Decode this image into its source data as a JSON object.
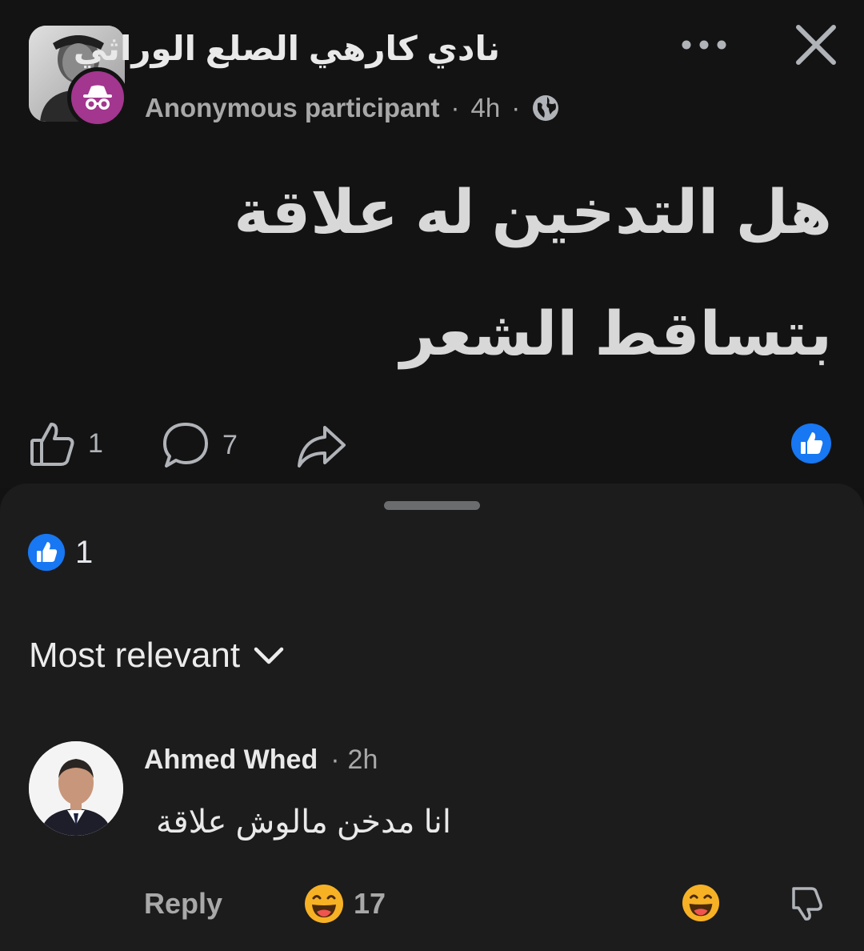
{
  "post": {
    "group_name": "نادي كارهي الصلع الوراثي",
    "author": "Anonymous participant",
    "separator": "·",
    "age": "4h",
    "privacy_icon": "globe-icon",
    "body": "هل التدخين له علاقة بتساقط الشعر",
    "like_count": "1",
    "comment_count": "7"
  },
  "sheet": {
    "reaction_count": "1",
    "sort_label": "Most relevant"
  },
  "comment": {
    "author": "Ahmed Whed",
    "separator": "·",
    "age": "2h",
    "text": "انا مدخن مالوش علاقة",
    "reply_label": "Reply",
    "reaction_count": "17"
  },
  "colors": {
    "background": "#121212",
    "sheet": "#1c1c1d",
    "like_blue": "#1877f2",
    "anon_badge": "#a3368e",
    "haha_yellow": "#f7b125"
  }
}
